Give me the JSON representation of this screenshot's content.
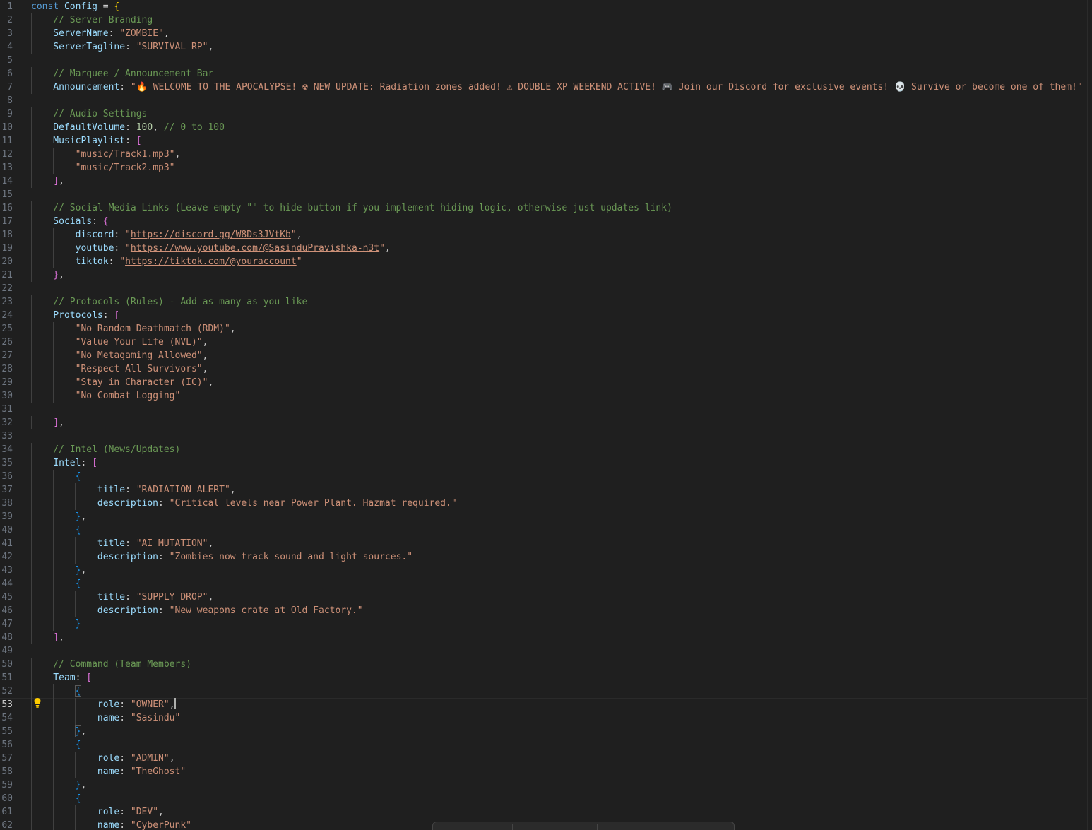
{
  "editor": {
    "active_line": 53,
    "lines": [
      [
        {
          "t": "keyword",
          "v": "const "
        },
        {
          "t": "ident",
          "v": "Config"
        },
        {
          "t": "punct",
          "v": " = "
        },
        {
          "t": "brace0",
          "v": "{"
        }
      ],
      [
        {
          "t": "comment",
          "v": "    // Server Branding"
        }
      ],
      [
        {
          "t": "prop",
          "v": "    ServerName"
        },
        {
          "t": "punct",
          "v": ": "
        },
        {
          "t": "string",
          "v": "\"ZOMBIE\""
        },
        {
          "t": "punct",
          "v": ","
        }
      ],
      [
        {
          "t": "prop",
          "v": "    ServerTagline"
        },
        {
          "t": "punct",
          "v": ": "
        },
        {
          "t": "string",
          "v": "\"SURVIVAL RP\""
        },
        {
          "t": "punct",
          "v": ","
        }
      ],
      [],
      [
        {
          "t": "comment",
          "v": "    // Marquee / Announcement Bar"
        }
      ],
      [
        {
          "t": "prop",
          "v": "    Announcement"
        },
        {
          "t": "punct",
          "v": ": "
        },
        {
          "t": "string",
          "v": "\"🔥 WELCOME TO THE APOCALYPSE! ☢ NEW UPDATE: Radiation zones added! ⚠ DOUBLE XP WEEKEND ACTIVE! 🎮 Join our Discord for exclusive events! 💀 Survive or become one of them!\""
        }
      ],
      [],
      [
        {
          "t": "comment",
          "v": "    // Audio Settings"
        }
      ],
      [
        {
          "t": "prop",
          "v": "    DefaultVolume"
        },
        {
          "t": "punct",
          "v": ": "
        },
        {
          "t": "number",
          "v": "100"
        },
        {
          "t": "punct",
          "v": ", "
        },
        {
          "t": "comment",
          "v": "// 0 to 100"
        }
      ],
      [
        {
          "t": "prop",
          "v": "    MusicPlaylist"
        },
        {
          "t": "punct",
          "v": ": "
        },
        {
          "t": "brace1",
          "v": "["
        }
      ],
      [
        {
          "t": "punct",
          "v": "        "
        },
        {
          "t": "string",
          "v": "\"music/Track1.mp3\""
        },
        {
          "t": "punct",
          "v": ","
        }
      ],
      [
        {
          "t": "punct",
          "v": "        "
        },
        {
          "t": "string",
          "v": "\"music/Track2.mp3\""
        }
      ],
      [
        {
          "t": "punct",
          "v": "    "
        },
        {
          "t": "brace1",
          "v": "]"
        },
        {
          "t": "punct",
          "v": ","
        }
      ],
      [],
      [
        {
          "t": "comment",
          "v": "    // Social Media Links (Leave empty \"\" to hide button if you implement hiding logic, otherwise just updates link)"
        }
      ],
      [
        {
          "t": "prop",
          "v": "    Socials"
        },
        {
          "t": "punct",
          "v": ": "
        },
        {
          "t": "brace1",
          "v": "{"
        }
      ],
      [
        {
          "t": "prop",
          "v": "        discord"
        },
        {
          "t": "punct",
          "v": ": "
        },
        {
          "t": "string",
          "v": "\""
        },
        {
          "t": "url",
          "v": "https://discord.gg/W8Ds3JVtKb"
        },
        {
          "t": "string",
          "v": "\""
        },
        {
          "t": "punct",
          "v": ","
        }
      ],
      [
        {
          "t": "prop",
          "v": "        youtube"
        },
        {
          "t": "punct",
          "v": ": "
        },
        {
          "t": "string",
          "v": "\""
        },
        {
          "t": "url",
          "v": "https://www.youtube.com/@SasinduPravishka-n3t"
        },
        {
          "t": "string",
          "v": "\""
        },
        {
          "t": "punct",
          "v": ","
        }
      ],
      [
        {
          "t": "prop",
          "v": "        tiktok"
        },
        {
          "t": "punct",
          "v": ": "
        },
        {
          "t": "string",
          "v": "\""
        },
        {
          "t": "url",
          "v": "https://tiktok.com/@youraccount"
        },
        {
          "t": "string",
          "v": "\""
        }
      ],
      [
        {
          "t": "punct",
          "v": "    "
        },
        {
          "t": "brace1",
          "v": "}"
        },
        {
          "t": "punct",
          "v": ","
        }
      ],
      [],
      [
        {
          "t": "comment",
          "v": "    // Protocols (Rules) - Add as many as you like"
        }
      ],
      [
        {
          "t": "prop",
          "v": "    Protocols"
        },
        {
          "t": "punct",
          "v": ": "
        },
        {
          "t": "brace1",
          "v": "["
        }
      ],
      [
        {
          "t": "punct",
          "v": "        "
        },
        {
          "t": "string",
          "v": "\"No Random Deathmatch (RDM)\""
        },
        {
          "t": "punct",
          "v": ","
        }
      ],
      [
        {
          "t": "punct",
          "v": "        "
        },
        {
          "t": "string",
          "v": "\"Value Your Life (NVL)\""
        },
        {
          "t": "punct",
          "v": ","
        }
      ],
      [
        {
          "t": "punct",
          "v": "        "
        },
        {
          "t": "string",
          "v": "\"No Metagaming Allowed\""
        },
        {
          "t": "punct",
          "v": ","
        }
      ],
      [
        {
          "t": "punct",
          "v": "        "
        },
        {
          "t": "string",
          "v": "\"Respect All Survivors\""
        },
        {
          "t": "punct",
          "v": ","
        }
      ],
      [
        {
          "t": "punct",
          "v": "        "
        },
        {
          "t": "string",
          "v": "\"Stay in Character (IC)\""
        },
        {
          "t": "punct",
          "v": ","
        }
      ],
      [
        {
          "t": "punct",
          "v": "        "
        },
        {
          "t": "string",
          "v": "\"No Combat Logging\""
        }
      ],
      [],
      [
        {
          "t": "punct",
          "v": "    "
        },
        {
          "t": "brace1",
          "v": "]"
        },
        {
          "t": "punct",
          "v": ","
        }
      ],
      [],
      [
        {
          "t": "comment",
          "v": "    // Intel (News/Updates)"
        }
      ],
      [
        {
          "t": "prop",
          "v": "    Intel"
        },
        {
          "t": "punct",
          "v": ": "
        },
        {
          "t": "brace1",
          "v": "["
        }
      ],
      [
        {
          "t": "punct",
          "v": "        "
        },
        {
          "t": "brace2",
          "v": "{"
        }
      ],
      [
        {
          "t": "prop",
          "v": "            title"
        },
        {
          "t": "punct",
          "v": ": "
        },
        {
          "t": "string",
          "v": "\"RADIATION ALERT\""
        },
        {
          "t": "punct",
          "v": ","
        }
      ],
      [
        {
          "t": "prop",
          "v": "            description"
        },
        {
          "t": "punct",
          "v": ": "
        },
        {
          "t": "string",
          "v": "\"Critical levels near Power Plant. Hazmat required.\""
        }
      ],
      [
        {
          "t": "punct",
          "v": "        "
        },
        {
          "t": "brace2",
          "v": "}"
        },
        {
          "t": "punct",
          "v": ","
        }
      ],
      [
        {
          "t": "punct",
          "v": "        "
        },
        {
          "t": "brace2",
          "v": "{"
        }
      ],
      [
        {
          "t": "prop",
          "v": "            title"
        },
        {
          "t": "punct",
          "v": ": "
        },
        {
          "t": "string",
          "v": "\"AI MUTATION\""
        },
        {
          "t": "punct",
          "v": ","
        }
      ],
      [
        {
          "t": "prop",
          "v": "            description"
        },
        {
          "t": "punct",
          "v": ": "
        },
        {
          "t": "string",
          "v": "\"Zombies now track sound and light sources.\""
        }
      ],
      [
        {
          "t": "punct",
          "v": "        "
        },
        {
          "t": "brace2",
          "v": "}"
        },
        {
          "t": "punct",
          "v": ","
        }
      ],
      [
        {
          "t": "punct",
          "v": "        "
        },
        {
          "t": "brace2",
          "v": "{"
        }
      ],
      [
        {
          "t": "prop",
          "v": "            title"
        },
        {
          "t": "punct",
          "v": ": "
        },
        {
          "t": "string",
          "v": "\"SUPPLY DROP\""
        },
        {
          "t": "punct",
          "v": ","
        }
      ],
      [
        {
          "t": "prop",
          "v": "            description"
        },
        {
          "t": "punct",
          "v": ": "
        },
        {
          "t": "string",
          "v": "\"New weapons crate at Old Factory.\""
        }
      ],
      [
        {
          "t": "punct",
          "v": "        "
        },
        {
          "t": "brace2",
          "v": "}"
        }
      ],
      [
        {
          "t": "punct",
          "v": "    "
        },
        {
          "t": "brace1",
          "v": "]"
        },
        {
          "t": "punct",
          "v": ","
        }
      ],
      [],
      [
        {
          "t": "comment",
          "v": "    // Command (Team Members)"
        }
      ],
      [
        {
          "t": "prop",
          "v": "    Team"
        },
        {
          "t": "punct",
          "v": ": "
        },
        {
          "t": "brace1",
          "v": "["
        }
      ],
      [
        {
          "t": "punct",
          "v": "        "
        },
        {
          "t": "bracematch",
          "v": "{"
        }
      ],
      [
        {
          "t": "prop",
          "v": "            role"
        },
        {
          "t": "punct",
          "v": ": "
        },
        {
          "t": "string",
          "v": "\"OWNER\""
        },
        {
          "t": "punct",
          "v": ","
        },
        {
          "t": "cursor",
          "v": ""
        }
      ],
      [
        {
          "t": "prop",
          "v": "            name"
        },
        {
          "t": "punct",
          "v": ": "
        },
        {
          "t": "string",
          "v": "\"Sasindu\""
        }
      ],
      [
        {
          "t": "punct",
          "v": "        "
        },
        {
          "t": "bracematch",
          "v": "}"
        },
        {
          "t": "punct",
          "v": ","
        }
      ],
      [
        {
          "t": "punct",
          "v": "        "
        },
        {
          "t": "brace2",
          "v": "{"
        }
      ],
      [
        {
          "t": "prop",
          "v": "            role"
        },
        {
          "t": "punct",
          "v": ": "
        },
        {
          "t": "string",
          "v": "\"ADMIN\""
        },
        {
          "t": "punct",
          "v": ","
        }
      ],
      [
        {
          "t": "prop",
          "v": "            name"
        },
        {
          "t": "punct",
          "v": ": "
        },
        {
          "t": "string",
          "v": "\"TheGhost\""
        }
      ],
      [
        {
          "t": "punct",
          "v": "        "
        },
        {
          "t": "brace2",
          "v": "}"
        },
        {
          "t": "punct",
          "v": ","
        }
      ],
      [
        {
          "t": "punct",
          "v": "        "
        },
        {
          "t": "brace2",
          "v": "{"
        }
      ],
      [
        {
          "t": "prop",
          "v": "            role"
        },
        {
          "t": "punct",
          "v": ": "
        },
        {
          "t": "string",
          "v": "\"DEV\""
        },
        {
          "t": "punct",
          "v": ","
        }
      ],
      [
        {
          "t": "prop",
          "v": "            name"
        },
        {
          "t": "punct",
          "v": ": "
        },
        {
          "t": "string",
          "v": "\"CyberPunk\""
        }
      ]
    ]
  },
  "icons": {
    "lightbulb": "lightbulb-icon"
  },
  "colors": {
    "background": "#1f1f1f",
    "keyword": "#569cd6",
    "property": "#9cdcfe",
    "string": "#ce9178",
    "comment": "#6a9955",
    "number": "#b5cea8"
  }
}
